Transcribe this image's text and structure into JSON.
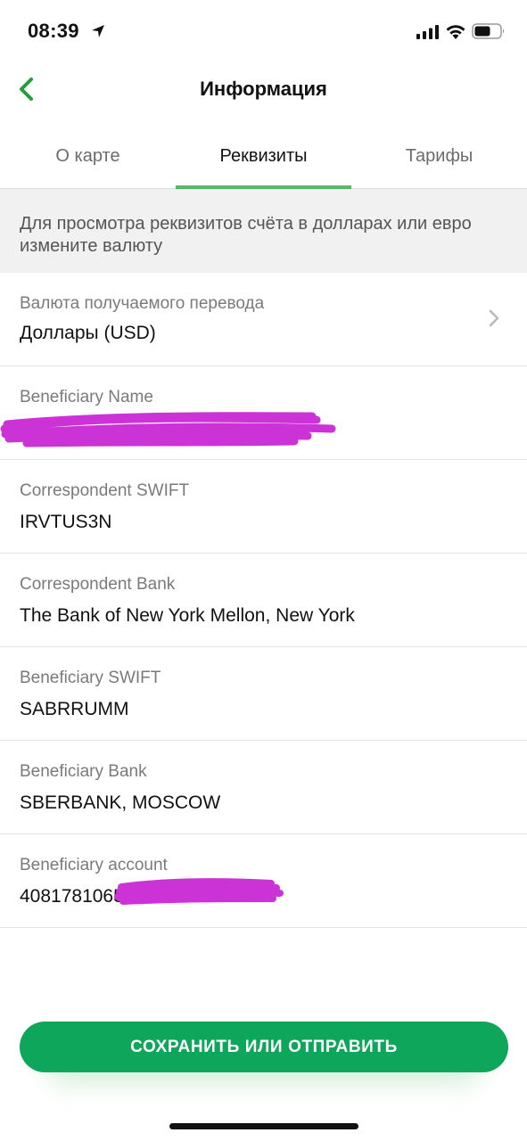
{
  "status_bar": {
    "time": "08:39",
    "icons": [
      "location-arrow-icon",
      "signal-icon",
      "wifi-icon",
      "battery-icon"
    ]
  },
  "nav": {
    "title": "Информация",
    "back_icon": "chevron-left-icon"
  },
  "tabs": [
    {
      "label": "О карте",
      "active": false
    },
    {
      "label": "Реквизиты",
      "active": true
    },
    {
      "label": "Тарифы",
      "active": false
    }
  ],
  "notice": {
    "text": "Для просмотра реквизитов счёта в долларах или евро измените валюту"
  },
  "details": [
    {
      "label": "Валюта получаемого перевода",
      "value": "Доллары (USD)"
    },
    {
      "label": "Beneficiary Name",
      "value": ""
    },
    {
      "label": "Correspondent SWIFT",
      "value": "IRVTUS3N"
    },
    {
      "label": "Correspondent Bank",
      "value": "The Bank of New York Mellon, New York"
    },
    {
      "label": "Beneficiary SWIFT",
      "value": "SABRRUMM"
    },
    {
      "label": "Beneficiary Bank",
      "value": "SBERBANK, MOSCOW"
    },
    {
      "label": "Beneficiary account",
      "value": "408178106555"
    }
  ],
  "action": {
    "label": "СОХРАНИТЬ ИЛИ ОТПРАВИТЬ"
  },
  "colors": {
    "accent": "#21a038",
    "button": "#0ea65a",
    "redaction": "#cc33d6"
  }
}
